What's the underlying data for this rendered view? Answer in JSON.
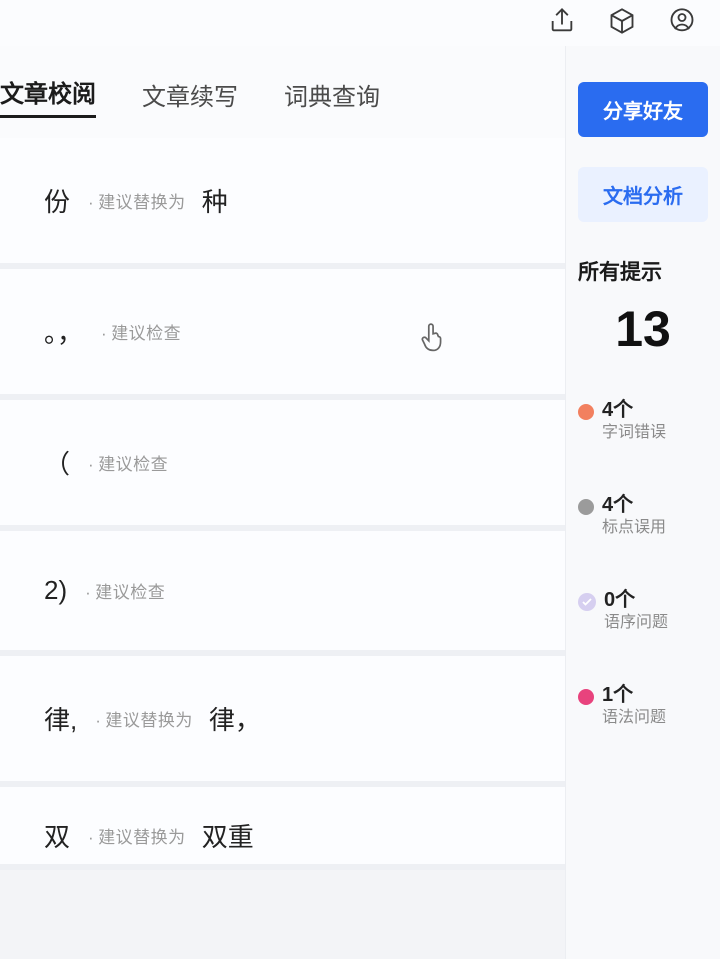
{
  "top_icons": {
    "share": "share-icon",
    "cube": "cube-icon",
    "avatar": "avatar-icon"
  },
  "tabs": [
    {
      "label": "文章校阅",
      "active": true
    },
    {
      "label": "文章续写",
      "active": false
    },
    {
      "label": "词典查询",
      "active": false
    }
  ],
  "suggestions": [
    {
      "orig": "份",
      "note": "建议替换为",
      "repl": "种",
      "cursor": false
    },
    {
      "orig": "。，",
      "note": "建议检查",
      "repl": "",
      "cursor": true
    },
    {
      "orig": "（",
      "note": "建议检查",
      "repl": "",
      "cursor": false
    },
    {
      "orig": "2)",
      "note": "建议检查",
      "repl": "",
      "cursor": false
    },
    {
      "orig": "律,",
      "note": "建议替换为",
      "repl": "律，",
      "cursor": false
    },
    {
      "orig": "双",
      "note": "建议替换为",
      "repl": "双重",
      "cursor": false
    }
  ],
  "side": {
    "share_label": "分享好友",
    "analyze_label": "文档分析",
    "all_hints_title": "所有提示",
    "total_count": "13",
    "categories": [
      {
        "count": "4个",
        "label": "字词错误",
        "color": "#f2805f",
        "type": "dot"
      },
      {
        "count": "4个",
        "label": "标点误用",
        "color": "#9b9b9b",
        "type": "dot"
      },
      {
        "count": "0个",
        "label": "语序问题",
        "color": "#d6cff0",
        "type": "check"
      },
      {
        "count": "1个",
        "label": "语法问题",
        "color": "#e8437d",
        "type": "dot"
      }
    ]
  }
}
